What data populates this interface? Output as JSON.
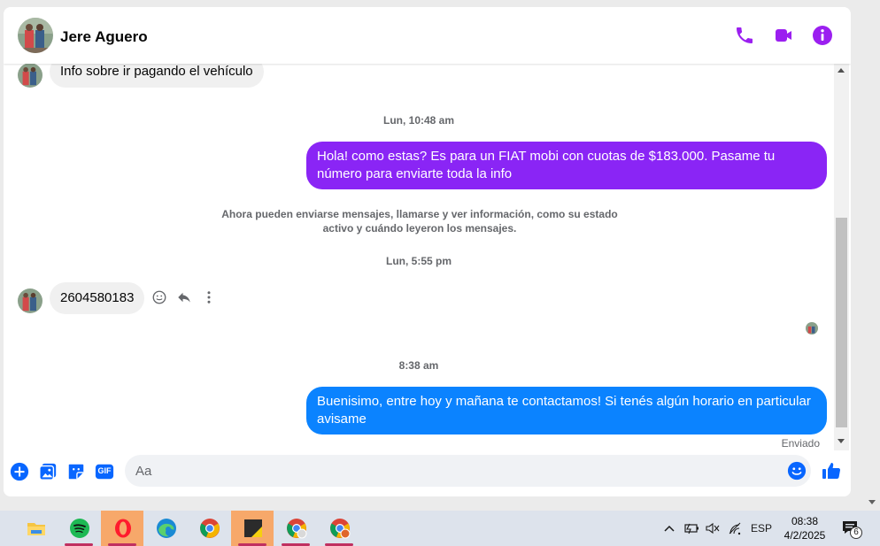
{
  "header": {
    "contact_name": "Jere Aguero",
    "icons": [
      "phone-icon",
      "video-camera-icon",
      "info-icon"
    ]
  },
  "colors": {
    "accent": "#9b1ff0",
    "outgoing_purple": "#8a25f5",
    "outgoing_blue": "#0b83ff",
    "incoming_bg": "#f0f0f0",
    "composer_icons": "#0866ff",
    "taskbar_bg": "#dde3ec"
  },
  "messages": {
    "incoming_1": "Info sobre ir pagando el vehículo",
    "timestamp_1": "Lun, 10:48 am",
    "outgoing_1": "Hola! como estas? Es para un FIAT mobi con cuotas de $183.000. Pasame tu número para enviarte toda la info",
    "notice_line1": "Ahora pueden enviarse mensajes, llamarse y ver información, como su estado",
    "notice_line2": "activo y cuándo leyeron los mensajes.",
    "timestamp_2": "Lun, 5:55 pm",
    "incoming_2": "2604580183",
    "timestamp_3": "8:38 am",
    "outgoing_2": "Buenisimo, entre hoy y mañana te contactamos! Si tenés algún horario en particular avisame",
    "status": "Enviado"
  },
  "message_actions": [
    "react-icon",
    "reply-icon",
    "more-options-icon"
  ],
  "composer": {
    "placeholder": "Aa",
    "value": "",
    "left_icons": [
      "plus-icon",
      "photo-icon",
      "sticker-icon",
      "gif-icon"
    ],
    "gif_label": "GIF",
    "right_icons": [
      "emoji-icon",
      "like-icon"
    ]
  },
  "taskbar": {
    "apps": [
      "file-explorer-icon",
      "spotify-icon",
      "opera-icon",
      "edge-icon",
      "chrome-icon",
      "sticky-notes-icon",
      "chrome-profile-icon",
      "chrome-profile-2-icon"
    ],
    "language": "ESP",
    "time": "08:38",
    "date": "4/2/2025",
    "notification_count": "6"
  }
}
